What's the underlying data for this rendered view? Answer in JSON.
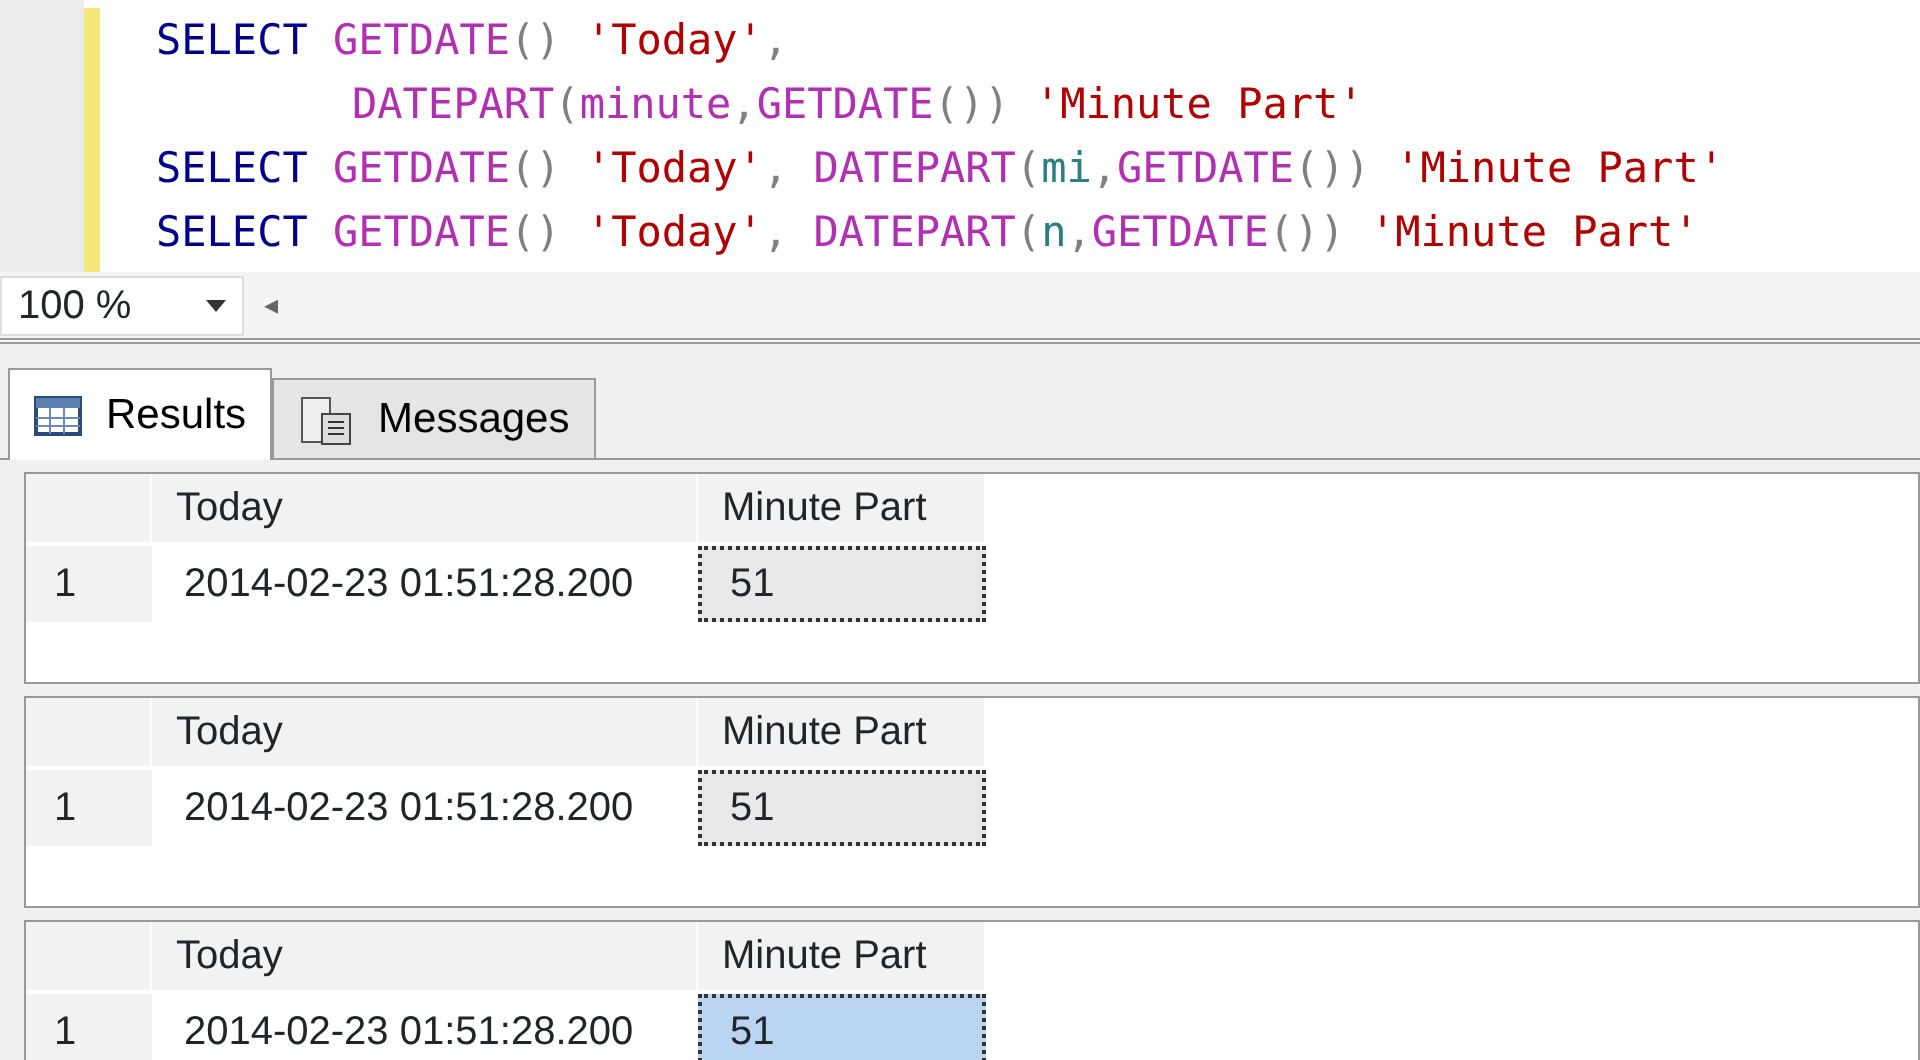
{
  "editor": {
    "lines": [
      {
        "indent": false,
        "tokens": [
          {
            "kind": "keyword",
            "text": "SELECT"
          },
          {
            "kind": "function",
            "text": " GETDATE"
          },
          {
            "kind": "punct",
            "text": "()"
          },
          {
            "kind": "string",
            "text": " 'Today'"
          },
          {
            "kind": "punct",
            "text": ","
          }
        ]
      },
      {
        "indent": true,
        "tokens": [
          {
            "kind": "function",
            "text": "DATEPART"
          },
          {
            "kind": "punct",
            "text": "("
          },
          {
            "kind": "function",
            "text": "minute"
          },
          {
            "kind": "punct",
            "text": ","
          },
          {
            "kind": "function",
            "text": "GETDATE"
          },
          {
            "kind": "punct",
            "text": "())"
          },
          {
            "kind": "string",
            "text": " 'Minute Part'"
          }
        ]
      },
      {
        "indent": false,
        "tokens": [
          {
            "kind": "keyword",
            "text": "SELECT"
          },
          {
            "kind": "function",
            "text": " GETDATE"
          },
          {
            "kind": "punct",
            "text": "()"
          },
          {
            "kind": "string",
            "text": " 'Today'"
          },
          {
            "kind": "punct",
            "text": ","
          },
          {
            "kind": "function",
            "text": " DATEPART"
          },
          {
            "kind": "punct",
            "text": "("
          },
          {
            "kind": "ident",
            "text": "mi"
          },
          {
            "kind": "punct",
            "text": ","
          },
          {
            "kind": "function",
            "text": "GETDATE"
          },
          {
            "kind": "punct",
            "text": "())"
          },
          {
            "kind": "string",
            "text": " 'Minute Part'"
          }
        ]
      },
      {
        "indent": false,
        "tokens": [
          {
            "kind": "keyword",
            "text": "SELECT"
          },
          {
            "kind": "function",
            "text": " GETDATE"
          },
          {
            "kind": "punct",
            "text": "()"
          },
          {
            "kind": "string",
            "text": " 'Today'"
          },
          {
            "kind": "punct",
            "text": ","
          },
          {
            "kind": "function",
            "text": " DATEPART"
          },
          {
            "kind": "punct",
            "text": "("
          },
          {
            "kind": "ident",
            "text": "n"
          },
          {
            "kind": "punct",
            "text": ","
          },
          {
            "kind": "function",
            "text": "GETDATE"
          },
          {
            "kind": "punct",
            "text": "())"
          },
          {
            "kind": "string",
            "text": " 'Minute Part'"
          }
        ]
      }
    ]
  },
  "zoom": {
    "value": "100 %",
    "arrow": "◂"
  },
  "tabs": [
    {
      "label": "Results",
      "selected": true,
      "kind": "grid"
    },
    {
      "label": "Messages",
      "selected": false,
      "kind": "messages"
    }
  ],
  "grids": [
    {
      "columns": [
        "Today",
        "Minute Part"
      ],
      "rows": [
        {
          "number": "1",
          "cells": [
            {
              "text": "2014-02-23 01:51:28.200",
              "focused": false,
              "selected": false
            },
            {
              "text": "51",
              "focused": true,
              "selected": false
            }
          ]
        }
      ]
    },
    {
      "columns": [
        "Today",
        "Minute Part"
      ],
      "rows": [
        {
          "number": "1",
          "cells": [
            {
              "text": "2014-02-23 01:51:28.200",
              "focused": false,
              "selected": false
            },
            {
              "text": "51",
              "focused": true,
              "selected": false
            }
          ]
        }
      ]
    },
    {
      "columns": [
        "Today",
        "Minute Part"
      ],
      "rows": [
        {
          "number": "1",
          "cells": [
            {
              "text": "2014-02-23 01:51:28.200",
              "focused": false,
              "selected": false
            },
            {
              "text": "51",
              "focused": true,
              "selected": true
            }
          ]
        }
      ]
    }
  ]
}
